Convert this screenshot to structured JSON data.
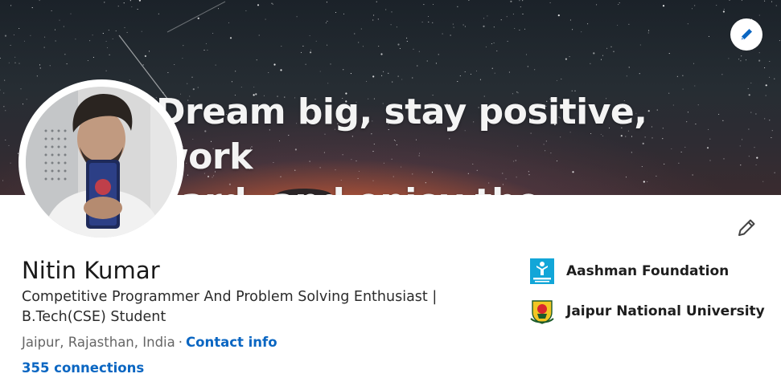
{
  "banner": {
    "quote_line1": "Dream big, stay positive, work",
    "quote_line2": "hard, and enjoy the journey.",
    "edit_icon": "pencil-icon"
  },
  "profile": {
    "name": "Nitin Kumar",
    "headline_line1": "Competitive Programmer And Problem Solving Enthusiast |",
    "headline_line2": "B.Tech(CSE) Student",
    "location": "Jaipur, Rajasthan, India",
    "separator": "·",
    "contact_info_label": "Contact info",
    "connections_label": "355 connections",
    "edit_icon": "pencil-icon"
  },
  "organizations": [
    {
      "name": "Aashman Foundation",
      "logo": "aashman-foundation-logo",
      "color": "#12a6d8"
    },
    {
      "name": "Jaipur National University",
      "logo": "jaipur-national-university-logo",
      "color": "#d9262e"
    }
  ],
  "colors": {
    "link": "#0a66c2",
    "text_primary": "#191919",
    "text_secondary": "#666666"
  }
}
